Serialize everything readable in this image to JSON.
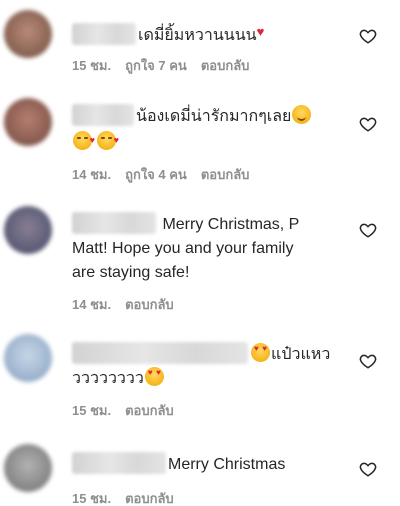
{
  "comments": [
    {
      "text": "เดมี่ยิ้มหวานนนน",
      "time": "15 ชม.",
      "likes": "ถูกใจ 7 คน",
      "reply": "ตอบกลับ",
      "avatar_color": "#9a7466"
    },
    {
      "text": "น้องเดมี่น่ารักมากๆเลย",
      "time": "14 ชม.",
      "likes": "ถูกใจ 4 คน",
      "reply": "ตอบกลับ",
      "avatar_color": "#8c5e52"
    },
    {
      "text_line1": "Merry Christmas, P",
      "text_line2": "Matt! Hope you and your family",
      "text_line3": "are staying safe!",
      "time": "14 ชม.",
      "reply": "ตอบกลับ",
      "avatar_color": "#5e5f7a"
    },
    {
      "text_line1": "แป๋วแหว",
      "text_line2": "วววววววว",
      "time": "15 ชม.",
      "reply": "ตอบกลับ",
      "avatar_color": "#9fb6d0"
    },
    {
      "text": "Merry Christmas",
      "time": "15 ชม.",
      "reply": "ตอบกลับ",
      "avatar_color": "#8a8a8a"
    }
  ],
  "icons": {
    "like": "heart-outline-icon"
  }
}
